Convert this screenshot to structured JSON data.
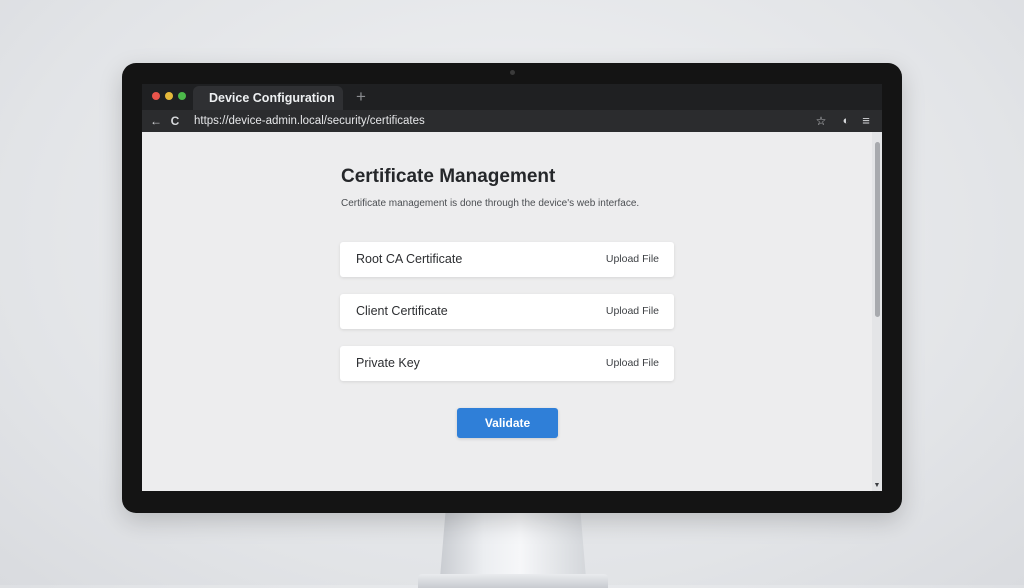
{
  "browser": {
    "tab_title": "Device Configuration",
    "new_tab_label": "+",
    "url": "https://device-admin.local/security/certificates",
    "icons": {
      "back": "←",
      "reload": "C",
      "bookmark": "☆",
      "profile": "◐",
      "menu": "≡"
    }
  },
  "page": {
    "title": "Certificate Management",
    "description": "Certificate management is done through the device's web interface.",
    "rows": [
      {
        "label": "Root CA Certificate",
        "action": "Upload File"
      },
      {
        "label": "Client Certificate",
        "action": "Upload File"
      },
      {
        "label": "Private Key",
        "action": "Upload File"
      }
    ],
    "validate_label": "Validate"
  },
  "colors": {
    "accent": "#2f7fd8",
    "traffic_red": "#e9544b",
    "traffic_yellow": "#e5b83a",
    "traffic_green": "#4cb94a"
  }
}
